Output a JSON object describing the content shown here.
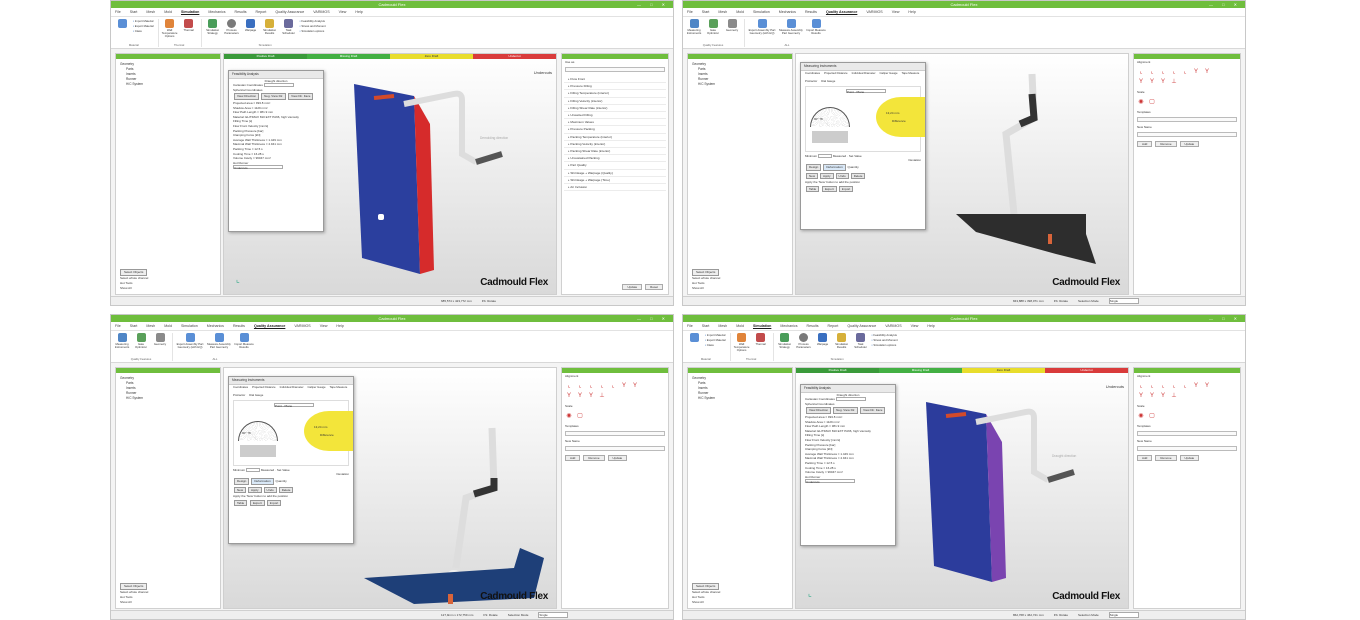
{
  "app": {
    "title": "Cadmould Flex",
    "brand": "Cadmould Flex",
    "window_controls": "— □ ✕"
  },
  "menu_home": [
    "File",
    "Start",
    "Mesh",
    "Mold",
    "Simulation",
    "Mechanics",
    "Results",
    "Report",
    "Quality Assurance",
    "VARIMOS",
    "View",
    "Help"
  ],
  "menu_qa": [
    "File",
    "Start",
    "Mesh",
    "Mold",
    "Simulation",
    "Mechanics",
    "Results",
    "Quality Assurance",
    "VARIMOS",
    "View",
    "Help"
  ],
  "panels": {
    "tl": {
      "active_tab": "Simulation",
      "right_label": "Undercuts",
      "direction_label": "Demolding direction",
      "status_size": "685,574 x 423,772 mm",
      "status_mode": "FS: Rotate"
    },
    "tr": {
      "active_tab": "Quality Assurance",
      "status_size": "843,888 x 398,071 mm",
      "status_mode": "FS: Rotate",
      "selection_mode_label": "Selection Mode",
      "selection_mode": "Single"
    },
    "bl": {
      "active_tab": "Quality Assurance",
      "status_size": "127,9mm x 172,759 mm",
      "status_mode": "FS: Rotate",
      "selection_mode_label": "Selection Mode",
      "selection_mode": "Single"
    },
    "br": {
      "active_tab": "Simulation",
      "right_label": "Undercuts",
      "direction_label": "Draught direction",
      "status_size": "862,768 x 462,721 mm",
      "status_mode": "FS: Rotate",
      "selection_mode_label": "Selection Mode",
      "selection_mode": "Single"
    }
  },
  "ribbon_sim": {
    "material": [
      "Import Material",
      "Export Material",
      "Class"
    ],
    "buttons": [
      "Material",
      "Wall Temperature Options",
      "Thermal"
    ],
    "groups": [
      "Material",
      "Thermal",
      "Simulation"
    ],
    "btns2": [
      "Simulation Strategy",
      "Process Parameters",
      "Warpage",
      "Shrink Deformation",
      "Simulation Results",
      "Task Scheduler"
    ],
    "list2": [
      "Feasibility Analysis",
      "Stress and Moment",
      "Simulation options"
    ]
  },
  "ribbon_qa": {
    "buttons": [
      "Measuring Instruments",
      "Gate Optimizer",
      "Geometry",
      "Export Assembly Part Geometry (with HQ)",
      "Measure Assembly Part Geometry",
      "Import Measure Results"
    ],
    "groups": [
      "Quality Features",
      "ALL"
    ]
  },
  "color_bar": [
    "Positive Draft",
    "Missing Draft",
    "Zero Draft",
    "Undercut"
  ],
  "tree": {
    "root": "Geometry",
    "children": [
      "Parts",
      "Inserts",
      "Runner",
      "H/C System"
    ]
  },
  "left_bottom": {
    "select_objects": "Select Objects",
    "select_whole": "Select whole channel",
    "hot_tools": "Hot Tools",
    "show_all": "Show All"
  },
  "undercut_dialog": {
    "title": "Feasibility Analysis",
    "section": "Draught direction",
    "cartesian": "Cartesian Coordinates",
    "cartesian_value": "Z Direction",
    "spherical": "Spherical Coordinates",
    "view_direction": "View Direction",
    "neg_view": "Neg. View Dir.",
    "view_dir_face": "View Dir. Face",
    "projected_area": "Projected area = 993.8 mm²",
    "shadow_area": "Shadow Area = 1129 mm²",
    "minimize": "Minimize",
    "flow_path": "Flow Path Length = 381.9 mm",
    "material": "Material: ELITIMAX 810 EXT PA66, high viscosity",
    "filling_time": "Filling Time [s]",
    "flow_front": "Flow Front Velocity [mm/s]",
    "packing": "Packing Pressure [bar]",
    "clamping": "Clamping Force [kN]",
    "avg_wall": "Average Wall Thickness = 1.449 mm",
    "max_wall": "Maximal Wall Thickness = 4.941 mm",
    "packing_time": "Packing Time = 12.5 s",
    "cooling_time": "Cooling Time = 16.28 s",
    "volume_cavity": "Volume Cavity = 96047 mm³",
    "default": "Default",
    "hot_runner": "Hot Runner",
    "undercuts": "Undercuts"
  },
  "measure_dialog": {
    "title": "Measuring Instruments",
    "tabs": [
      "Coordinates",
      "Projected Distance",
      "Individual Diameter",
      "Caliper Gauge",
      "Tape Measure",
      "Protractor",
      "Dial Gauge"
    ],
    "select": "Point - Plane",
    "readout_1": "90° 78",
    "readout_2": "13,24 mm",
    "readout_3": "Difference",
    "minimum": "Minimum",
    "measured": "Measured",
    "set_value": "Set Value",
    "deviation": "Deviation",
    "design": "Design",
    "deformation": "Deformation",
    "quantity": "Quantity",
    "new": "New",
    "apply": "Apply",
    "undo": "Undo",
    "delete": "Delete",
    "hint": "Apply the 'New' button to add the position",
    "table": "Table",
    "export": "Export",
    "import": "Import"
  },
  "align_panel": {
    "title": "Alignment",
    "scale": "Scale",
    "templates": "Templates",
    "new_name": "New Name",
    "add": "Add",
    "remove": "Remove",
    "update": "Update"
  },
  "analysis_panel": {
    "header": "Use as",
    "items": [
      "Flow Front",
      "Pressure Filling",
      "Filling Temperature (interior)",
      "Filling Velocity (interior)",
      "Filling Shear Rate (interior)",
      "Unwetted Filling",
      "Maximum Values",
      "Pressure Packing",
      "Packing Temperature (interior)",
      "Packing Velocity (interior)",
      "Packing Shear Rate (interior)",
      "Unsustained Packing",
      "Part Quality",
      "Shrinkage + Warpage (Quality)",
      "Shrinkage + Warpage (Time)",
      "Air Inclusion"
    ],
    "btn_1": "Update",
    "btn_2": "Reset"
  },
  "colors": {
    "titlebar": "#6fbe3d",
    "positive": "#3a9a3a",
    "missing": "#3fa83f",
    "zero": "#e8dd2c",
    "undercut": "#d93b3b",
    "part_blue": "#2b3f9e",
    "part_red": "#d62b2b"
  }
}
